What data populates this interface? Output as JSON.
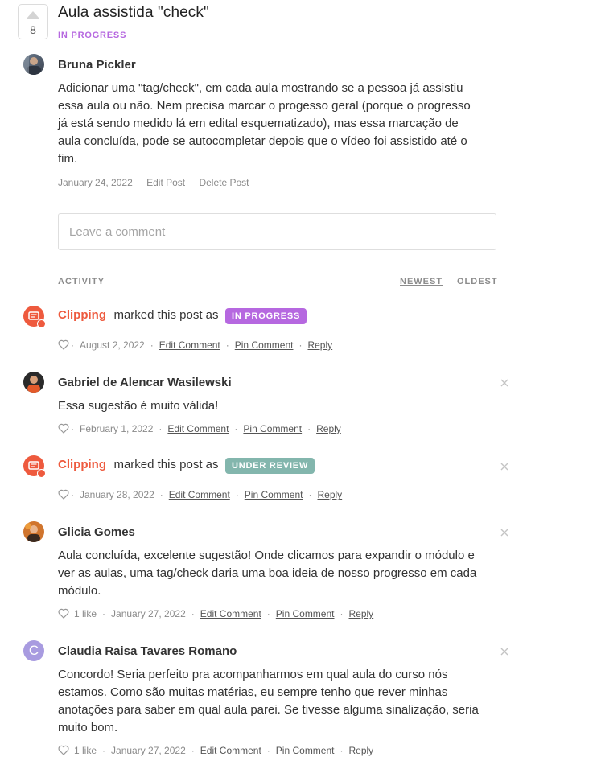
{
  "post": {
    "votes": "8",
    "title": "Aula assistida \"check\"",
    "status": "IN PROGRESS",
    "status_color": "#b668e0",
    "author": "Bruna Pickler",
    "body_lines": [
      "Adicionar uma \"tag/check\", em cada aula mostrando se a pessoa já assistiu",
      "essa aula ou não. Nem precisa marcar o progesso geral (porque o progresso",
      "já está sendo medido lá em edital esquematizado), mas essa marcação de",
      "aula concluída, pode se autocompletar depois que o vídeo foi assistido até o",
      "fim."
    ],
    "date": "January 24, 2022",
    "edit_label": "Edit Post",
    "delete_label": "Delete Post"
  },
  "comment_input": {
    "placeholder": "Leave a comment"
  },
  "activity": {
    "label": "ACTIVITY",
    "sort_newest": "NEWEST",
    "sort_oldest": "OLDEST"
  },
  "labels": {
    "marked_text": "marked this post as",
    "edit_comment": "Edit Comment",
    "pin_comment": "Pin Comment",
    "reply": "Reply",
    "sep": "·"
  },
  "colors": {
    "clipping": "#ee5a3e",
    "in_progress": "#b668e0",
    "under_review": "#83b6ad",
    "avatar_claudia": "#a89be0"
  },
  "items": [
    {
      "type": "status",
      "author": "Clipping",
      "badge": "IN PROGRESS",
      "date": "August 2, 2022"
    },
    {
      "type": "comment",
      "author": "Gabriel de Alencar Wasilewski",
      "body_lines": [
        "Essa sugestão é muito válida!"
      ],
      "date": "February 1, 2022"
    },
    {
      "type": "status",
      "author": "Clipping",
      "badge": "UNDER REVIEW",
      "date": "January 28, 2022"
    },
    {
      "type": "comment",
      "author": "Glicia Gomes",
      "body_lines": [
        "Aula concluída, excelente sugestão! Onde clicamos para expandir o módulo e",
        "ver as aulas, uma tag/check daria uma boa ideia de nosso progresso em cada",
        "módulo."
      ],
      "likes": "1 like",
      "date": "January 27, 2022"
    },
    {
      "type": "comment",
      "author": "Claudia Raisa Tavares Romano",
      "avatar_letter": "C",
      "body_lines": [
        "Concordo! Seria perfeito pra acompanharmos em qual aula do curso nós",
        "estamos. Como são muitas matérias, eu sempre tenho que rever minhas",
        "anotações para saber em qual aula parei. Se tivesse alguma sinalização, seria",
        "muito bom."
      ],
      "likes": "1 like",
      "date": "January 27, 2022"
    }
  ]
}
